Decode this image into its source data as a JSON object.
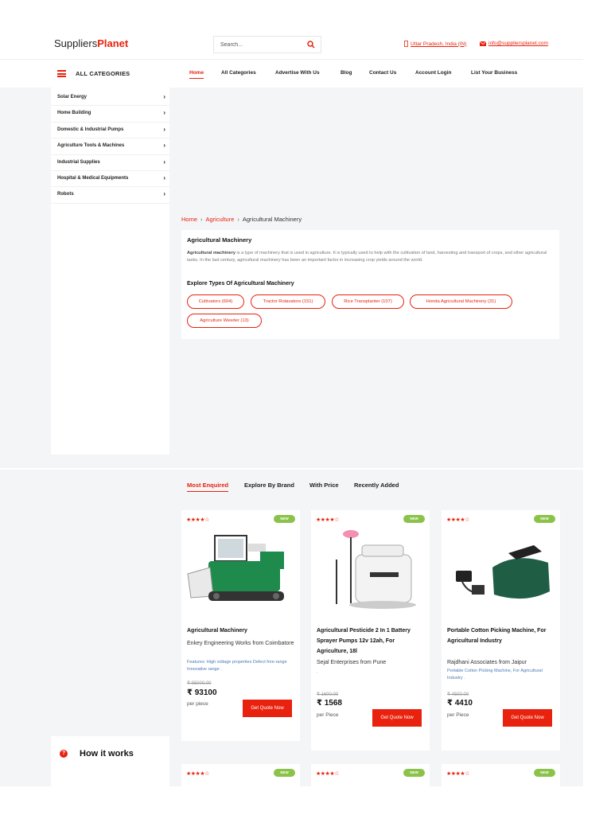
{
  "header": {
    "logo_part1": "Suppliers",
    "logo_part2": "Planet",
    "search_placeholder": "Search...",
    "location": "Uttar Pradesh, India (IN)",
    "email": "info@suppliersplanet.com"
  },
  "nav": {
    "all_categories_label": "ALL CATEGORIES",
    "items": [
      "Home",
      "All Categories",
      "Advertise With Us",
      "Blog",
      "Contact Us",
      "Account Login",
      "List Your Business"
    ]
  },
  "sidebar": {
    "categories": [
      "Solar Energy",
      "Home Building",
      "Domestic & Industrial Pumps",
      "Agriculture Tools & Machines",
      "Industrial Supplies",
      "Hospital & Medical Equipments",
      "Robots"
    ],
    "chevron": "›"
  },
  "breadcrumb": {
    "home": "Home",
    "parent": "Agriculture",
    "current": "Agricultural Machinery",
    "separator": "›"
  },
  "info": {
    "title": "Agricultural Machinery",
    "desc_bold": "Agricultural machinery",
    "desc_rest": " is a type of machinery that is used in agriculture. It is typically used to help with the cultivation of land, harvesting and transport of crops, and other agricultural tasks. In the last century, agricultural machinery has been an important factor in increasing crop yields around the world.",
    "explore_title": "Explore Types Of Agricultural Machinery",
    "chips": [
      "Cultivators (604)",
      "Tractor Rotavators (151)",
      "Rice Transplanter (107)",
      "Honda Agricultural Machinery (31)",
      "Agriculture Weeder (13)"
    ]
  },
  "product_tabs": [
    "Most Enquired",
    "Explore By Brand",
    "With Price",
    "Recently Added"
  ],
  "products": [
    {
      "stars": "★★★★☆",
      "rating": 4,
      "badge": "NEW",
      "name": "Agricultural Machinery",
      "seller": "Enkey Engineering Works from Coimbatore",
      "features": "Features:  High voltage properties  Defect free-range  Innovative range .",
      "old_price": "₹ 95000.00",
      "price": "₹ 93100",
      "unit": "per piece",
      "cta": "Get Quote Now"
    },
    {
      "stars": "★★★★☆",
      "rating": 4,
      "badge": "NEW",
      "name": "Agricultural Pesticide 2 In 1 Battery Sprayer Pumps 12v 12ah, For Agriculture, 18l",
      "seller": "Sejal Enterprises from Pune",
      "features": ".",
      "old_price": "₹ 1600.00",
      "price": "₹ 1568",
      "unit": "per Piece",
      "cta": "Get Quote Now"
    },
    {
      "stars": "★★★★☆",
      "rating": 4,
      "badge": "NEW",
      "name": "Portable Cotton Picking Machine, For Agricultural Industry",
      "seller": "Rajdhani Associates from Jaipur",
      "features": "Portable Cotton Picking Machine, For Agricultural Industry .",
      "old_price": "₹ 4500.00",
      "price": "₹ 4410",
      "unit": "per Piece",
      "cta": "Get Quote Now"
    }
  ],
  "next_row": [
    {
      "stars": "★★★★☆",
      "badge": "NEW"
    },
    {
      "stars": "★★★★☆",
      "badge": "NEW"
    },
    {
      "stars": "★★★★☆",
      "badge": "NEW"
    }
  ],
  "how_it_works": {
    "icon_glyph": "?",
    "title": "How it works"
  },
  "colors": {
    "brand": "#e8220e",
    "badge": "#8bc34a",
    "feature_text": "#4a78b7",
    "background_grey": "#f4f5f7"
  },
  "icons": [
    "search-icon",
    "location-pin-icon",
    "mail-icon",
    "hamburger-icon",
    "chevron-right-icon",
    "question-icon"
  ]
}
